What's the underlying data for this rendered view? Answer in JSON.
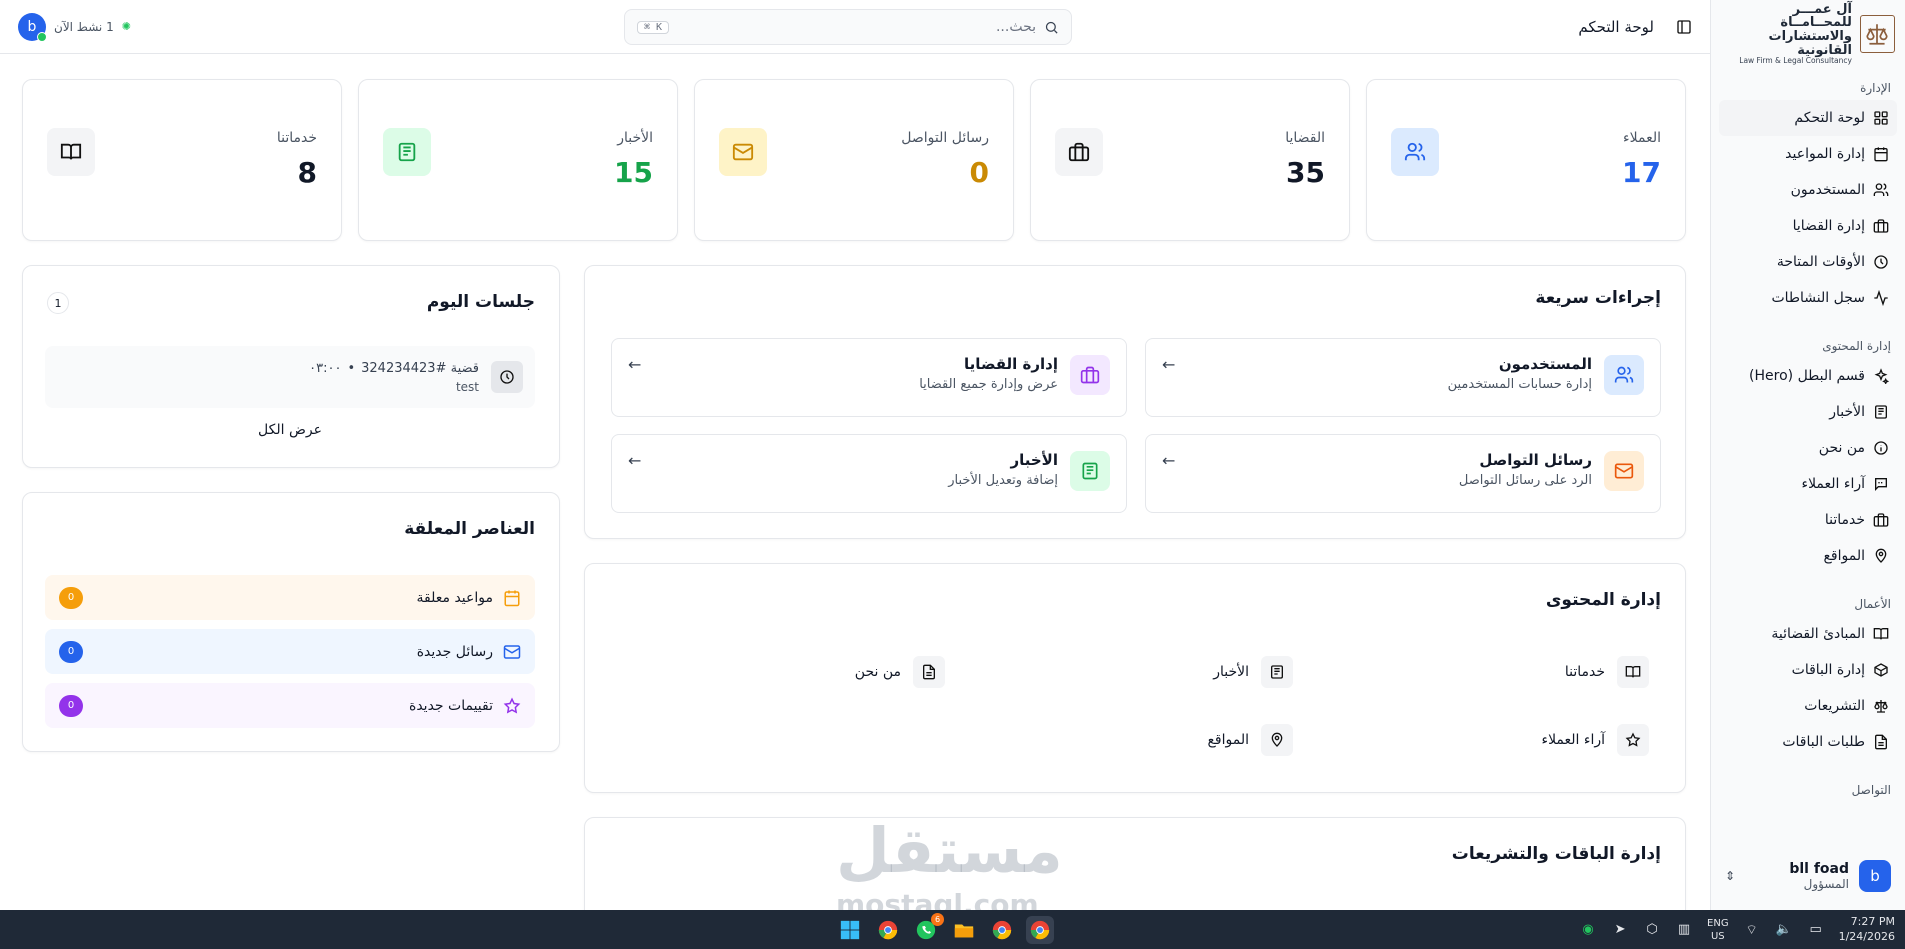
{
  "brand": {
    "line1": "آل عمـــر للمحــامــاة",
    "line2": "والاستشارات القانونية",
    "en": "Law Firm & Legal Consultancy"
  },
  "sidebar": {
    "sections": [
      {
        "label": "الإدارة",
        "items": [
          {
            "label": "لوحة التحكم",
            "icon": "dashboard-grid-icon",
            "active": true
          },
          {
            "label": "إدارة المواعيد",
            "icon": "calendar-icon"
          },
          {
            "label": "المستخدمون",
            "icon": "users-icon"
          },
          {
            "label": "إدارة القضايا",
            "icon": "briefcase-icon"
          },
          {
            "label": "الأوقات المتاحة",
            "icon": "clock-icon"
          },
          {
            "label": "سجل النشاطات",
            "icon": "activity-icon"
          }
        ]
      },
      {
        "label": "إدارة المحتوى",
        "items": [
          {
            "label": "قسم البطل (Hero)",
            "icon": "sparkles-icon"
          },
          {
            "label": "الأخبار",
            "icon": "newspaper-icon"
          },
          {
            "label": "من نحن",
            "icon": "info-icon"
          },
          {
            "label": "آراء العملاء",
            "icon": "message-quote-icon"
          },
          {
            "label": "خدماتنا",
            "icon": "briefcase-icon"
          },
          {
            "label": "المواقع",
            "icon": "map-pin-icon"
          }
        ]
      },
      {
        "label": "الأعمال",
        "items": [
          {
            "label": "المبادئ القضائية",
            "icon": "book-open-icon"
          },
          {
            "label": "إدارة الباقات",
            "icon": "package-icon"
          },
          {
            "label": "التشريعات",
            "icon": "scale-icon"
          },
          {
            "label": "طلبات الباقات",
            "icon": "file-text-icon"
          }
        ]
      },
      {
        "label": "التواصل",
        "items": []
      }
    ],
    "user": {
      "initial": "b",
      "name": "bll foad",
      "role": "المسؤول"
    }
  },
  "topbar": {
    "title": "لوحة التحكم",
    "search_placeholder": "بحث...",
    "search_shortcut": "⌘ K",
    "online_text": "1 نشط الآن",
    "avatar_initial": "b"
  },
  "stats": [
    {
      "label": "العملاء",
      "value": "17",
      "color": "#2563eb",
      "icon_bg": "#dbeafe",
      "icon": "users-icon"
    },
    {
      "label": "القضايا",
      "value": "35",
      "color": "#111827",
      "icon_bg": "#f3f4f6",
      "icon": "briefcase-icon"
    },
    {
      "label": "رسائل التواصل",
      "value": "0",
      "color": "#ca8a04",
      "icon_bg": "#fef3c7",
      "icon": "mail-icon"
    },
    {
      "label": "الأخبار",
      "value": "15",
      "color": "#16a34a",
      "icon_bg": "#dcfce7",
      "icon": "newspaper-icon"
    },
    {
      "label": "خدماتنا",
      "value": "8",
      "color": "#111827",
      "icon_bg": "#f3f4f6",
      "icon": "book-open-icon"
    }
  ],
  "quick_actions": {
    "title": "إجراءات سريعة",
    "items": [
      {
        "title": "المستخدمون",
        "desc": "إدارة حسابات المستخدمين",
        "icon": "users-icon",
        "icon_bg": "#dbeafe",
        "icon_color": "#2563eb"
      },
      {
        "title": "إدارة القضايا",
        "desc": "عرض وإدارة جميع القضايا",
        "icon": "briefcase-icon",
        "icon_bg": "#f3e8ff",
        "icon_color": "#9333ea"
      },
      {
        "title": "رسائل التواصل",
        "desc": "الرد على رسائل التواصل",
        "icon": "mail-icon",
        "icon_bg": "#ffedd5",
        "icon_color": "#ea580c"
      },
      {
        "title": "الأخبار",
        "desc": "إضافة وتعديل الأخبار",
        "icon": "newspaper-icon",
        "icon_bg": "#dcfce7",
        "icon_color": "#16a34a"
      }
    ]
  },
  "content_mgmt": {
    "title": "إدارة المحتوى",
    "items": [
      {
        "label": "خدماتنا",
        "icon": "book-open-icon"
      },
      {
        "label": "الأخبار",
        "icon": "newspaper-icon"
      },
      {
        "label": "من نحن",
        "icon": "file-text-icon"
      },
      {
        "label": "آراء العملاء",
        "icon": "star-icon"
      },
      {
        "label": "المواقع",
        "icon": "map-pin-icon"
      }
    ]
  },
  "packages": {
    "title": "إدارة الباقات والتشريعات"
  },
  "today_sessions": {
    "title": "جلسات اليوم",
    "count": "1",
    "session_time": "٠٣:٠٠",
    "session_case": "قضية #324234423",
    "session_client": "test",
    "view_all": "عرض الكل"
  },
  "pending": {
    "title": "العناصر المعلقة",
    "items": [
      {
        "label": "مواعيد معلقة",
        "count": "0",
        "bg": "#fff7ed",
        "color": "#f59e0b",
        "icon": "calendar-icon"
      },
      {
        "label": "رسائل جديدة",
        "count": "0",
        "bg": "#eff6ff",
        "color": "#2563eb",
        "icon": "mail-icon"
      },
      {
        "label": "تقييمات جديدة",
        "count": "0",
        "bg": "#faf5ff",
        "color": "#9333ea",
        "icon": "star-icon"
      }
    ]
  },
  "watermark": {
    "ar": "مستقل",
    "en": "mostaql.com"
  },
  "taskbar": {
    "lang1": "ENG",
    "lang2": "US",
    "time": "7:27 PM",
    "date": "1/24/2026",
    "whatsapp_badge": "6",
    "apps": [
      "windows-start-icon",
      "chrome-icon",
      "whatsapp-icon",
      "file-explorer-icon",
      "chrome-icon",
      "chrome-icon"
    ]
  }
}
